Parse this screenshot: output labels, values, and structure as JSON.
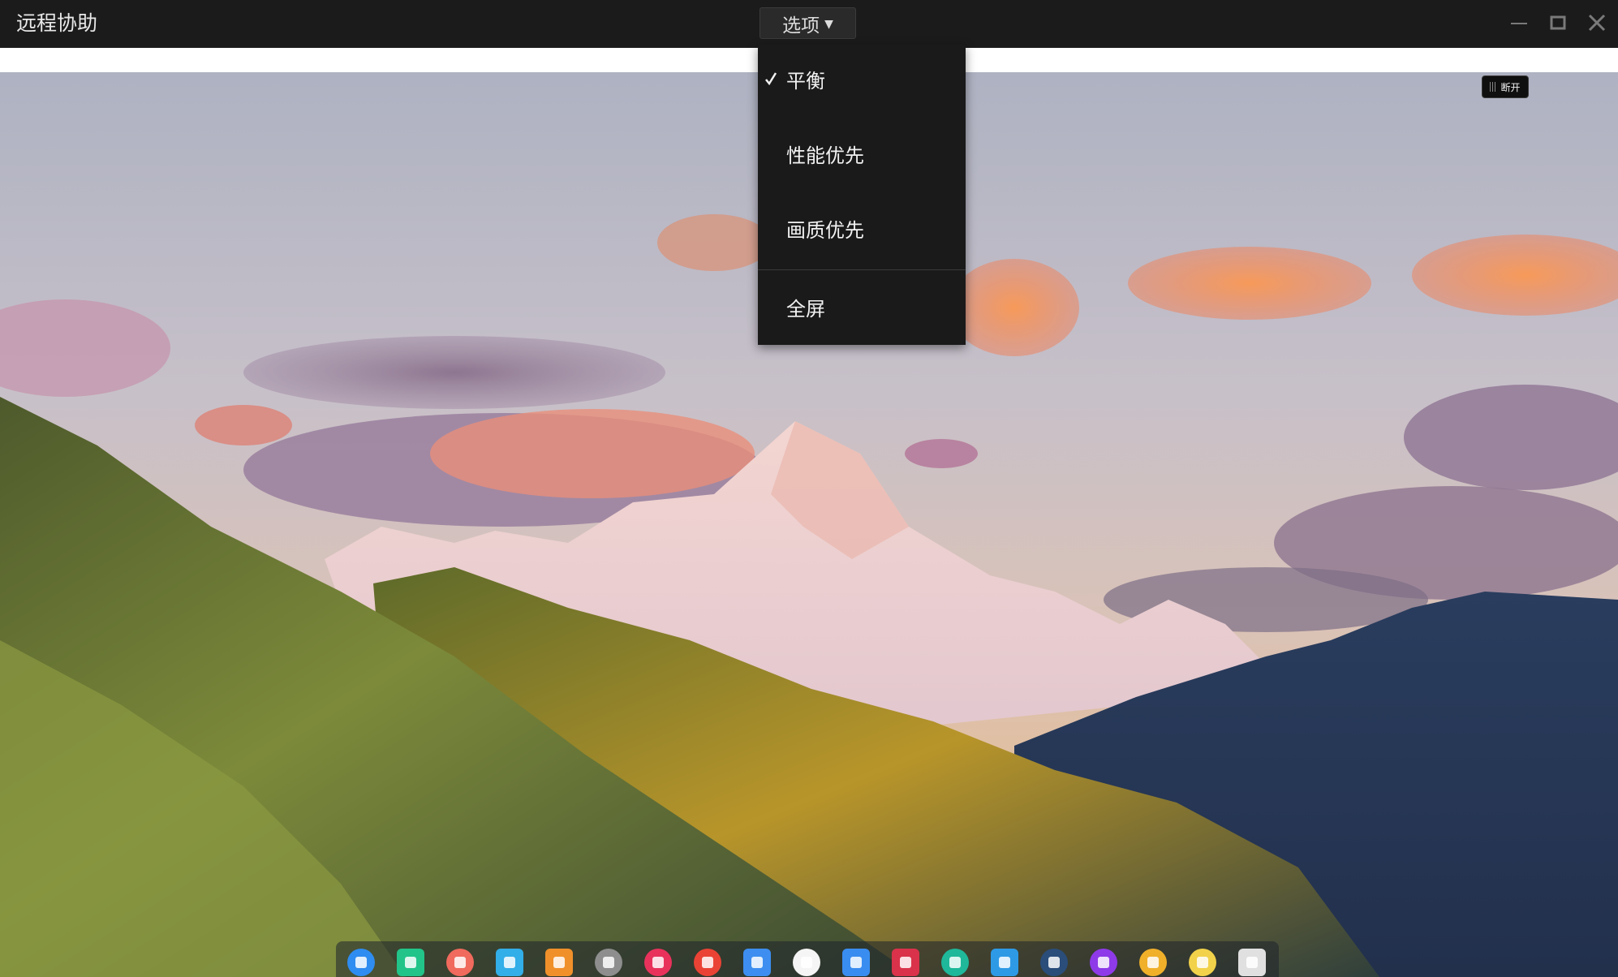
{
  "window": {
    "title": "远程协助",
    "options_label": "选项",
    "controls": [
      "minimize-icon",
      "maximize-icon",
      "close-icon"
    ]
  },
  "options_menu": {
    "items": [
      {
        "label": "平衡",
        "checked": true
      },
      {
        "label": "性能优先",
        "checked": false
      },
      {
        "label": "画质优先",
        "checked": false
      },
      {
        "label": "全屏",
        "checked": false
      }
    ]
  },
  "remote": {
    "disconnect_label": "断开",
    "wallpaper": "mountain-sunset"
  },
  "dock": {
    "icons": [
      {
        "name": "launcher-icon",
        "color": "#2f8cf0"
      },
      {
        "name": "file-manager-icon",
        "color": "#22c48a"
      },
      {
        "name": "screen-recorder-icon",
        "color": "#f06a5d"
      },
      {
        "name": "app-store-icon",
        "color": "#32aee8"
      },
      {
        "name": "archive-icon",
        "color": "#f0902a"
      },
      {
        "name": "settings-icon",
        "color": "#8e8e8e"
      },
      {
        "name": "screenshot-icon",
        "color": "#e8325c"
      },
      {
        "name": "chrome-icon",
        "color": "#ea4335"
      },
      {
        "name": "multitask-icon",
        "color": "#3d8ef0"
      },
      {
        "name": "feedback-icon",
        "color": "#f5f5f5"
      },
      {
        "name": "notes-icon",
        "color": "#3a8df0"
      },
      {
        "name": "terminal-icon",
        "color": "#d9324a"
      },
      {
        "name": "security-icon",
        "color": "#1fb89a"
      },
      {
        "name": "store-bag-icon",
        "color": "#2e9ae6"
      },
      {
        "name": "recorder-icon",
        "color": "#2a4d7a"
      },
      {
        "name": "power-icon",
        "color": "#8e3ae8"
      },
      {
        "name": "browser-icon",
        "color": "#f0b02a"
      },
      {
        "name": "calendar-icon",
        "color": "#f2d24a"
      },
      {
        "name": "trash-icon",
        "color": "#e0e0e0"
      }
    ]
  },
  "colors": {
    "titlebar": "#1b1b1b",
    "menu_bg": "#1a1a1a",
    "menu_text": "#f2f2f2"
  }
}
